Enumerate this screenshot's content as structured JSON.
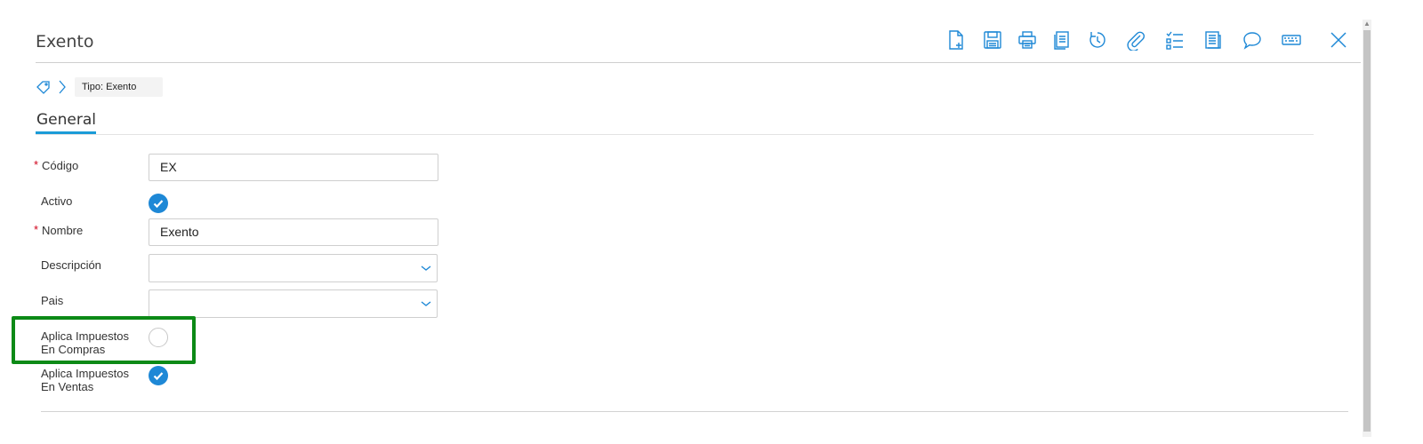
{
  "window": {
    "title": "Exento"
  },
  "toolbar": {
    "buttons": [
      {
        "name": "new-record"
      },
      {
        "name": "save"
      },
      {
        "name": "print"
      },
      {
        "name": "copy"
      },
      {
        "name": "history"
      },
      {
        "name": "attach"
      },
      {
        "name": "checklist"
      },
      {
        "name": "report"
      },
      {
        "name": "chat"
      },
      {
        "name": "keyboard"
      },
      {
        "name": "close"
      }
    ]
  },
  "breadcrumb": {
    "chip": "Tipo: Exento"
  },
  "tabs": [
    {
      "label": "General",
      "active": true
    }
  ],
  "form": {
    "codigo": {
      "label": "Código",
      "required": true,
      "value": "EX"
    },
    "activo": {
      "label": "Activo",
      "checked": true
    },
    "nombre": {
      "label": "Nombre",
      "required": true,
      "value": "Exento"
    },
    "descripcion": {
      "label": "Descripción",
      "value": ""
    },
    "pais": {
      "label": "Pais",
      "value": ""
    },
    "aplica_compras": {
      "label_line1": "Aplica Impuestos",
      "label_line2": "En Compras",
      "checked": false
    },
    "aplica_ventas": {
      "label_line1": "Aplica Impuestos",
      "label_line2": "En Ventas",
      "checked": true
    }
  },
  "colors": {
    "accent": "#1a9bd7",
    "check": "#1e88d6",
    "required": "#d0021b",
    "highlight": "#0c8a16"
  }
}
